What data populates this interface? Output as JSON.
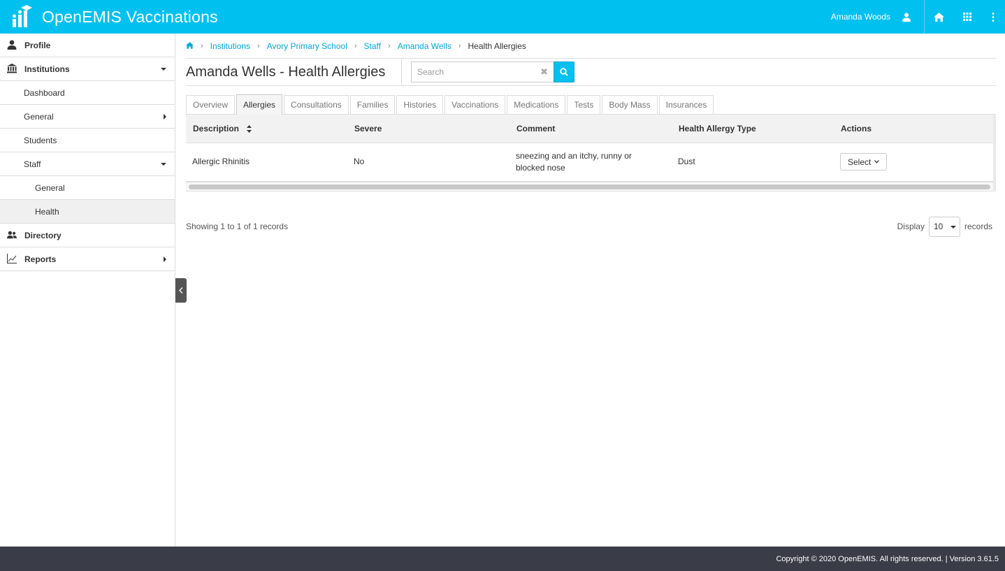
{
  "app": {
    "title": "OpenEMIS Vaccinations",
    "brand_color": "#00c0ef"
  },
  "header": {
    "user_name": "Amanda Woods",
    "icons": [
      "user-icon",
      "home-icon",
      "grid-icon",
      "more-vertical-icon"
    ]
  },
  "sidebar": {
    "items": [
      {
        "label": "Profile",
        "icon": "user-icon"
      },
      {
        "label": "Institutions",
        "icon": "institution-icon"
      },
      {
        "label": "Dashboard"
      },
      {
        "label": "General"
      },
      {
        "label": "Students"
      },
      {
        "label": "Staff"
      },
      {
        "label": "General"
      },
      {
        "label": "Health"
      },
      {
        "label": "Directory",
        "icon": "users-icon"
      },
      {
        "label": "Reports",
        "icon": "chart-icon"
      }
    ]
  },
  "breadcrumb": {
    "items": [
      "Institutions",
      "Avory Primary School",
      "Staff",
      "Amanda Wells"
    ],
    "current": "Health Allergies",
    "separator": "›"
  },
  "page": {
    "title": "Amanda Wells - Health Allergies"
  },
  "search": {
    "placeholder": "Search",
    "value": ""
  },
  "tabs": [
    {
      "label": "Overview"
    },
    {
      "label": "Allergies",
      "active": true
    },
    {
      "label": "Consultations"
    },
    {
      "label": "Families"
    },
    {
      "label": "Histories"
    },
    {
      "label": "Vaccinations"
    },
    {
      "label": "Medications"
    },
    {
      "label": "Tests"
    },
    {
      "label": "Body Mass"
    },
    {
      "label": "Insurances"
    }
  ],
  "table": {
    "columns": [
      "Description",
      "Severe",
      "Comment",
      "Health Allergy Type",
      "Actions"
    ],
    "rows": [
      {
        "description": "Allergic Rhinitis",
        "severe": "No",
        "comment": "sneezing and an itchy, runny or blocked nose",
        "type": "Dust",
        "action": "Select"
      }
    ]
  },
  "pagination": {
    "summary": "Showing 1 to 1 of 1 records",
    "display_label": "Display",
    "display_value": "10",
    "records_label": "records"
  },
  "footer": {
    "copyright": "Copyright © 2020 OpenEMIS. All rights reserved. | Version 3.61.5"
  }
}
